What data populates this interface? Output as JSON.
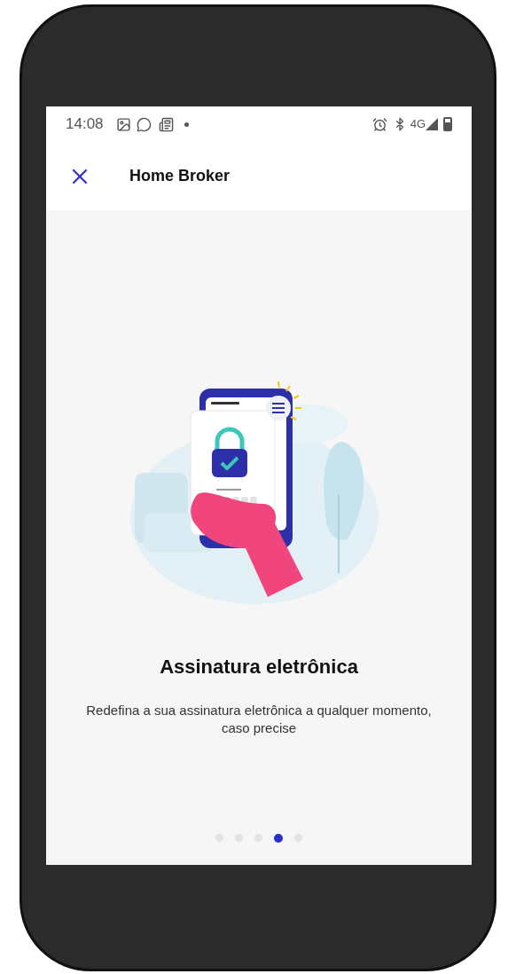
{
  "status_bar": {
    "time": "14:08",
    "network": "4G"
  },
  "app_bar": {
    "title": "Home Broker"
  },
  "slide": {
    "title": "Assinatura eletrônica",
    "description": "Redefina a sua assinatura eletrônica a qualquer momento, caso precise"
  },
  "pager": [
    {
      "selected": false
    },
    {
      "selected": false
    },
    {
      "selected": false
    },
    {
      "selected": true
    },
    {
      "selected": false
    }
  ]
}
